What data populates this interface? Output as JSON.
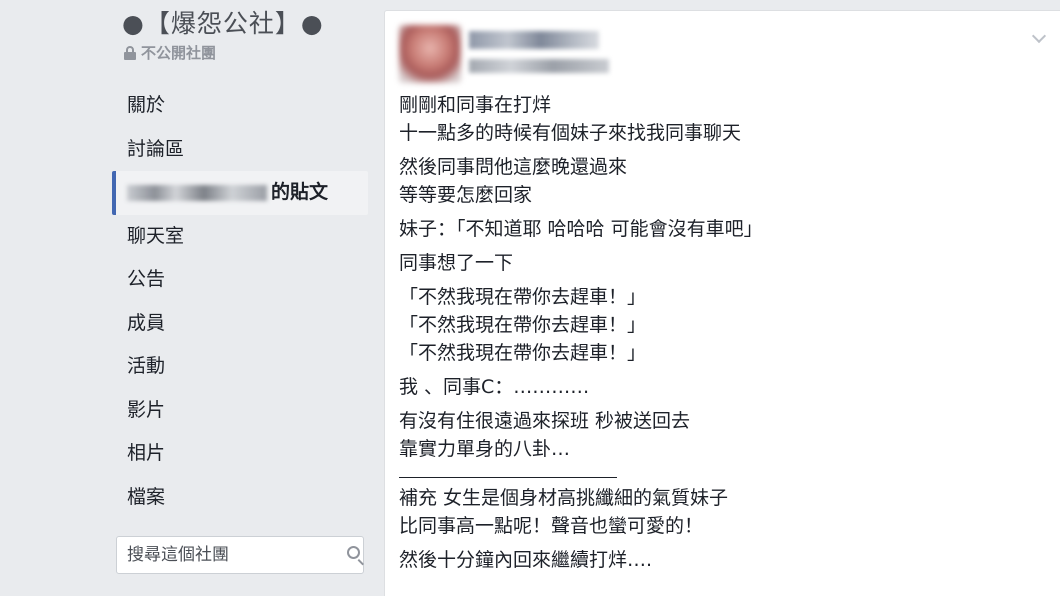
{
  "sidebar": {
    "group_title": "●【爆怨公社】●",
    "privacy_label": "不公開社團",
    "nav": [
      {
        "label": "關於"
      },
      {
        "label": "討論區"
      },
      {
        "label": "的貼文",
        "blurred_prefix": true,
        "active": true
      },
      {
        "label": "聊天室"
      },
      {
        "label": "公告"
      },
      {
        "label": "成員"
      },
      {
        "label": "活動"
      },
      {
        "label": "影片"
      },
      {
        "label": "相片"
      },
      {
        "label": "檔案"
      }
    ],
    "search": {
      "placeholder": "搜尋這個社團"
    }
  },
  "post": {
    "paragraphs": [
      [
        "剛剛和同事在打烊",
        "十一點多的時候有個妹子來找我同事聊天"
      ],
      [
        "然後同事問他這麼晚還過來",
        "等等要怎麼回家"
      ],
      [
        "妹子：「不知道耶 哈哈哈 可能會沒有車吧」"
      ],
      [
        "同事想了一下"
      ],
      [
        "「不然我現在帶你去趕車！」",
        "「不然我現在帶你去趕車！」",
        "「不然我現在帶你去趕車！」"
      ],
      [
        "我 、同事C：…………"
      ],
      [
        "有沒有住很遠過來探班 秒被送回去",
        "靠實力單身的八卦…"
      ]
    ],
    "supplement": [
      [
        "補充 女生是個身材高挑纖細的氣質妹子",
        "比同事高一點呢！聲音也蠻可愛的！"
      ],
      [
        "然後十分鐘內回來繼續打烊…."
      ]
    ]
  }
}
